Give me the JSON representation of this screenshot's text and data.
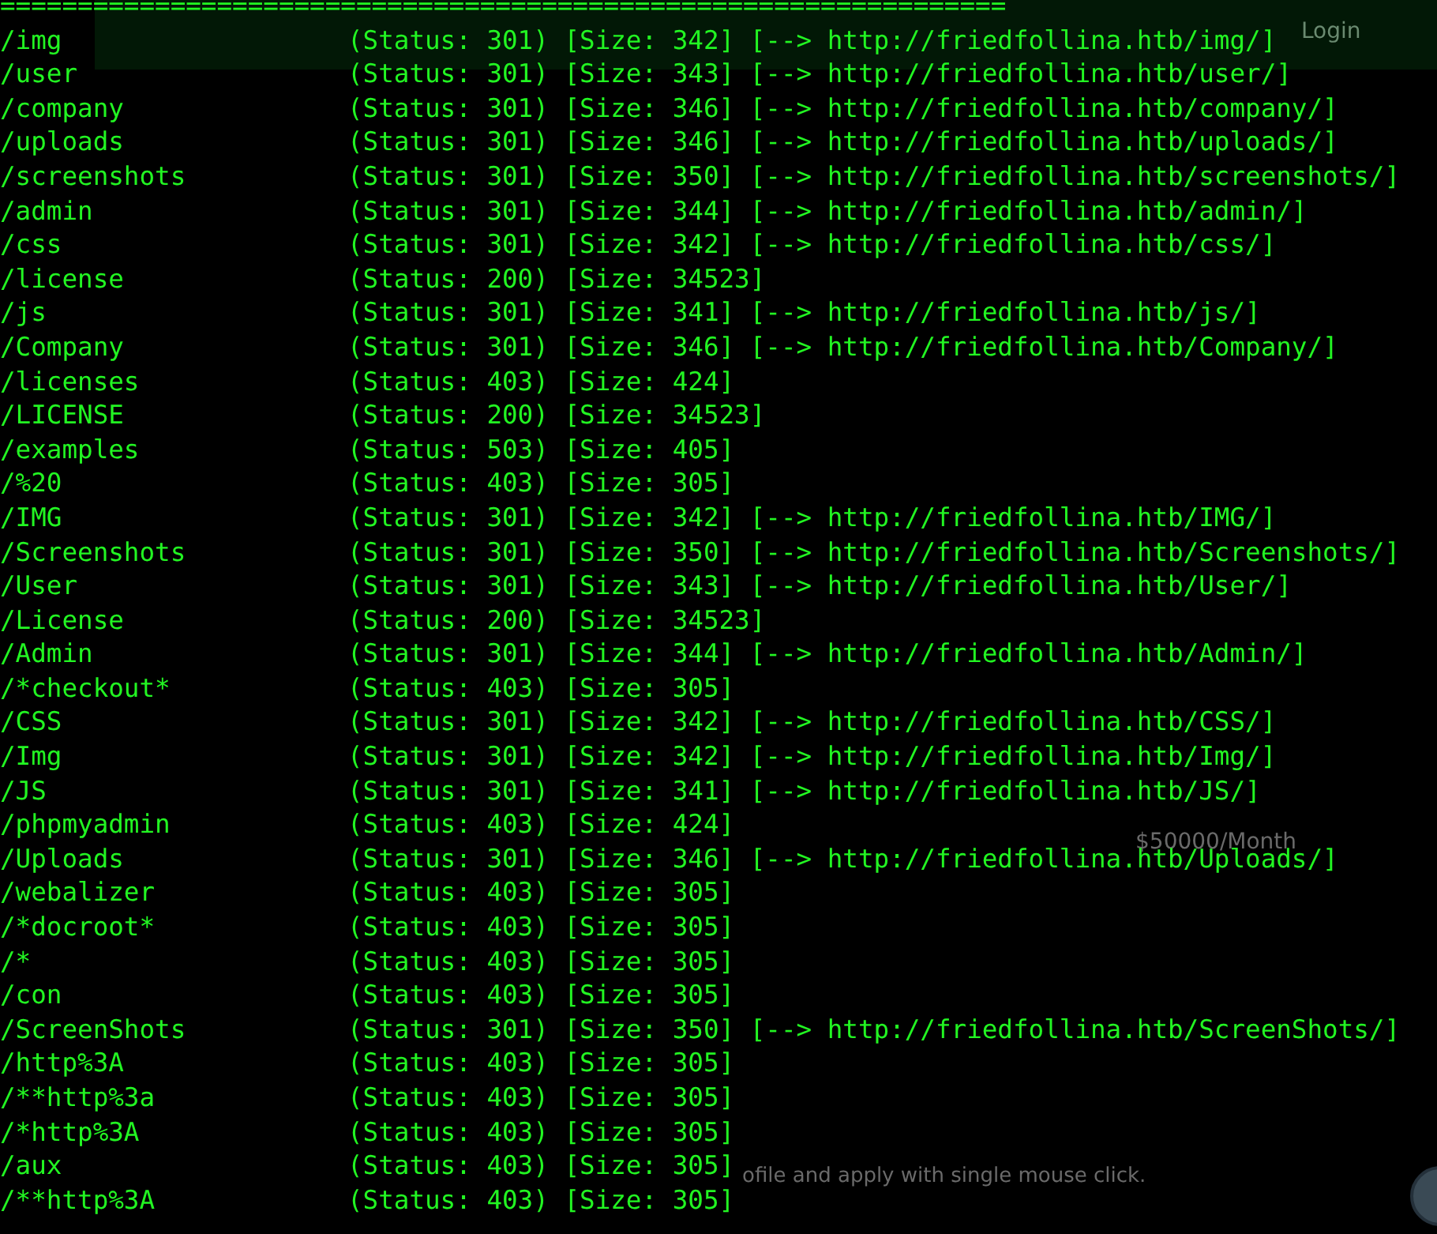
{
  "backdrop": {
    "login": "Login",
    "salary": "$50000/Month",
    "tagline": "ofile and apply with single mouse click."
  },
  "separator": "=================================================================",
  "rows": [
    {
      "path": "/img",
      "status": "(Status: 301)",
      "size": "[Size: 342]",
      "redirect": "[--> http://friedfollina.htb/img/]"
    },
    {
      "path": "/user",
      "status": "(Status: 301)",
      "size": "[Size: 343]",
      "redirect": "[--> http://friedfollina.htb/user/]"
    },
    {
      "path": "/company",
      "status": "(Status: 301)",
      "size": "[Size: 346]",
      "redirect": "[--> http://friedfollina.htb/company/]"
    },
    {
      "path": "/uploads",
      "status": "(Status: 301)",
      "size": "[Size: 346]",
      "redirect": "[--> http://friedfollina.htb/uploads/]"
    },
    {
      "path": "/screenshots",
      "status": "(Status: 301)",
      "size": "[Size: 350]",
      "redirect": "[--> http://friedfollina.htb/screenshots/]"
    },
    {
      "path": "/admin",
      "status": "(Status: 301)",
      "size": "[Size: 344]",
      "redirect": "[--> http://friedfollina.htb/admin/]"
    },
    {
      "path": "/css",
      "status": "(Status: 301)",
      "size": "[Size: 342]",
      "redirect": "[--> http://friedfollina.htb/css/]"
    },
    {
      "path": "/license",
      "status": "(Status: 200)",
      "size": "[Size: 34523]"
    },
    {
      "path": "/js",
      "status": "(Status: 301)",
      "size": "[Size: 341]",
      "redirect": "[--> http://friedfollina.htb/js/]"
    },
    {
      "path": "/Company",
      "status": "(Status: 301)",
      "size": "[Size: 346]",
      "redirect": "[--> http://friedfollina.htb/Company/]"
    },
    {
      "path": "/licenses",
      "status": "(Status: 403)",
      "size": "[Size: 424]"
    },
    {
      "path": "/LICENSE",
      "status": "(Status: 200)",
      "size": "[Size: 34523]"
    },
    {
      "path": "/examples",
      "status": "(Status: 503)",
      "size": "[Size: 405]"
    },
    {
      "path": "/%20",
      "status": "(Status: 403)",
      "size": "[Size: 305]"
    },
    {
      "path": "/IMG",
      "status": "(Status: 301)",
      "size": "[Size: 342]",
      "redirect": "[--> http://friedfollina.htb/IMG/]"
    },
    {
      "path": "/Screenshots",
      "status": "(Status: 301)",
      "size": "[Size: 350]",
      "redirect": "[--> http://friedfollina.htb/Screenshots/]"
    },
    {
      "path": "/User",
      "status": "(Status: 301)",
      "size": "[Size: 343]",
      "redirect": "[--> http://friedfollina.htb/User/]"
    },
    {
      "path": "/License",
      "status": "(Status: 200)",
      "size": "[Size: 34523]"
    },
    {
      "path": "/Admin",
      "status": "(Status: 301)",
      "size": "[Size: 344]",
      "redirect": "[--> http://friedfollina.htb/Admin/]"
    },
    {
      "path": "/*checkout*",
      "status": "(Status: 403)",
      "size": "[Size: 305]"
    },
    {
      "path": "/CSS",
      "status": "(Status: 301)",
      "size": "[Size: 342]",
      "redirect": "[--> http://friedfollina.htb/CSS/]"
    },
    {
      "path": "/Img",
      "status": "(Status: 301)",
      "size": "[Size: 342]",
      "redirect": "[--> http://friedfollina.htb/Img/]"
    },
    {
      "path": "/JS",
      "status": "(Status: 301)",
      "size": "[Size: 341]",
      "redirect": "[--> http://friedfollina.htb/JS/]"
    },
    {
      "path": "/phpmyadmin",
      "status": "(Status: 403)",
      "size": "[Size: 424]"
    },
    {
      "path": "/Uploads",
      "status": "(Status: 301)",
      "size": "[Size: 346]",
      "redirect": "[--> http://friedfollina.htb/Uploads/]"
    },
    {
      "path": "/webalizer",
      "status": "(Status: 403)",
      "size": "[Size: 305]"
    },
    {
      "path": "/*docroot*",
      "status": "(Status: 403)",
      "size": "[Size: 305]"
    },
    {
      "path": "/*",
      "status": "(Status: 403)",
      "size": "[Size: 305]"
    },
    {
      "path": "/con",
      "status": "(Status: 403)",
      "size": "[Size: 305]"
    },
    {
      "path": "/ScreenShots",
      "status": "(Status: 301)",
      "size": "[Size: 350]",
      "redirect": "[--> http://friedfollina.htb/ScreenShots/]"
    },
    {
      "path": "/http%3A",
      "status": "(Status: 403)",
      "size": "[Size: 305]"
    },
    {
      "path": "/**http%3a",
      "status": "(Status: 403)",
      "size": "[Size: 305]"
    },
    {
      "path": "/*http%3A",
      "status": "(Status: 403)",
      "size": "[Size: 305]"
    },
    {
      "path": "/aux",
      "status": "(Status: 403)",
      "size": "[Size: 305]"
    },
    {
      "path": "/**http%3A",
      "status": "(Status: 403)",
      "size": "[Size: 305]"
    }
  ]
}
